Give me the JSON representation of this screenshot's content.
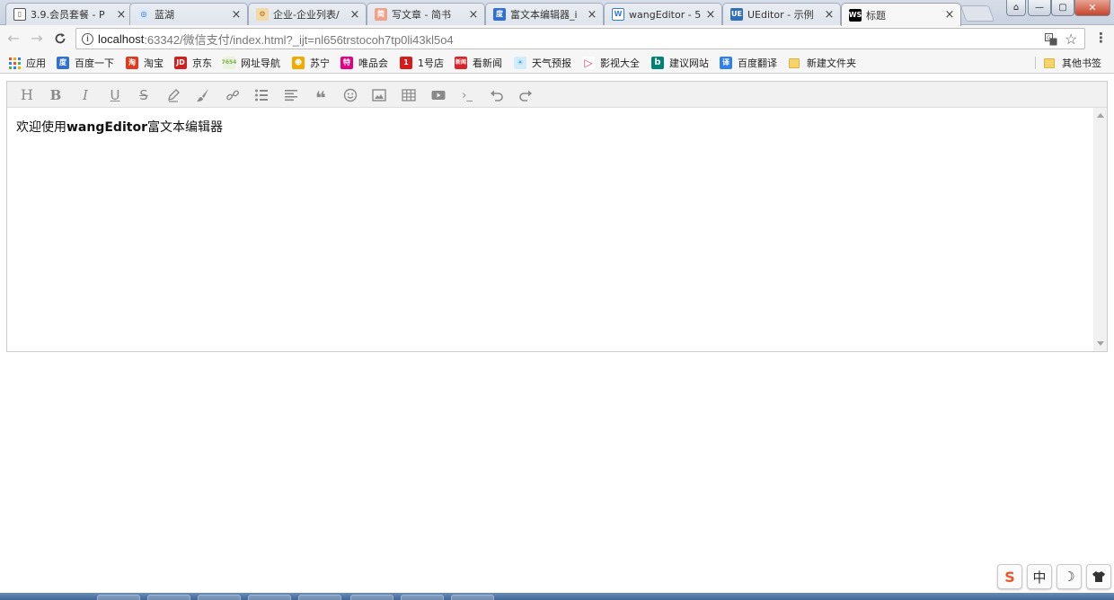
{
  "window": {
    "tabs": [
      {
        "title": "3.9.会员套餐 - P",
        "icon": "book-icon",
        "active": false
      },
      {
        "title": "蓝湖",
        "icon": "lanhu-icon",
        "active": false
      },
      {
        "title": "企业-企业列表/",
        "icon": "gear-icon",
        "active": false
      },
      {
        "title": "写文章 - 简书",
        "icon": "jianshu-icon",
        "active": false
      },
      {
        "title": "富文本编辑器_i",
        "icon": "baidu-icon",
        "active": false
      },
      {
        "title": "wangEditor - 5",
        "icon": "wangeditor-icon",
        "active": false
      },
      {
        "title": "UEditor - 示例",
        "icon": "ueditor-icon",
        "active": false
      },
      {
        "title": "标题",
        "icon": "webstorm-icon",
        "active": true
      }
    ],
    "close_glyph": "×",
    "controls": {
      "minimize": "—",
      "maximize": "▢",
      "close": "✕",
      "user": "⌂"
    }
  },
  "toolbar": {
    "back": "←",
    "forward": "→",
    "reload": "C",
    "url_host": "localhost",
    "url_rest": ":63342/微信支付/index.html?_ijt=nl656trstocoh7tp0li43kl5o4",
    "info": "i",
    "translate_icon": "translate-icon",
    "star": "☆",
    "menu": "⋮"
  },
  "bookmarks": {
    "items": [
      {
        "label": "应用",
        "icon": "apps-icon",
        "color": "#e4572e"
      },
      {
        "label": "百度一下",
        "icon": "baidu-icon",
        "color": "#2f6fd6"
      },
      {
        "label": "淘宝",
        "icon": "taobao-icon",
        "color": "#e03a1e"
      },
      {
        "label": "京东",
        "icon": "jd-icon",
        "color": "#d01f1f"
      },
      {
        "label": "网址导航",
        "icon": "nav-icon",
        "color": "#7fb24a"
      },
      {
        "label": "苏宁",
        "icon": "suning-icon",
        "color": "#f2a900"
      },
      {
        "label": "唯品会",
        "icon": "vip-icon",
        "color": "#e4007f"
      },
      {
        "label": "1号店",
        "icon": "yhd-icon",
        "color": "#d61b1b"
      },
      {
        "label": "看新闻",
        "icon": "news-icon",
        "color": "#d6262c"
      },
      {
        "label": "天气预报",
        "icon": "weather-icon",
        "color": "#3aa3e3"
      },
      {
        "label": "影视大全",
        "icon": "video-icon",
        "color": "#e23d6a"
      },
      {
        "label": "建议网站",
        "icon": "bing-icon",
        "color": "#008373"
      },
      {
        "label": "百度翻译",
        "icon": "fanyi-icon",
        "color": "#2f80ed"
      },
      {
        "label": "新建文件夹",
        "icon": "folder-icon",
        "color": "#f6d46a"
      }
    ],
    "other": "其他书签"
  },
  "editor": {
    "toolbar_icons": [
      "heading-icon",
      "bold-icon",
      "italic-icon",
      "underline-icon",
      "strikethrough-icon",
      "pencil-icon",
      "brush-icon",
      "link-icon",
      "list-icon",
      "align-icon",
      "quote-icon",
      "emoji-icon",
      "image-icon",
      "table-icon",
      "video-icon",
      "code-icon",
      "undo-icon",
      "redo-icon"
    ],
    "content_prefix": "欢迎使用",
    "content_bold": "wangEditor",
    "content_suffix": "富文本编辑器"
  },
  "ime": {
    "sogou": "S",
    "lang": "中",
    "moon": "☽",
    "shirt": "shirt-icon"
  }
}
